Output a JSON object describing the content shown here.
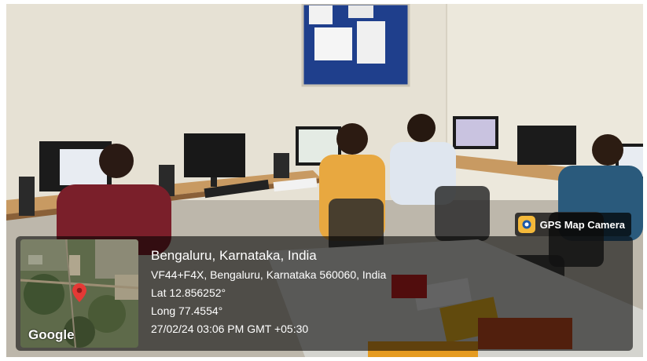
{
  "badge": {
    "label": "GPS Map Camera",
    "icon": "camera-pin-icon"
  },
  "map": {
    "provider": "Google",
    "marker_icon": "location-pin-icon",
    "marker_color": "#e53935"
  },
  "location": {
    "city": "Bengaluru, Karnataka, India",
    "address": "VF44+F4X, Bengaluru, Karnataka 560060, India",
    "latitude": "Lat 12.856252°",
    "longitude": "Long 77.4554°",
    "timestamp": "27/02/24 03:06 PM GMT +05:30"
  }
}
